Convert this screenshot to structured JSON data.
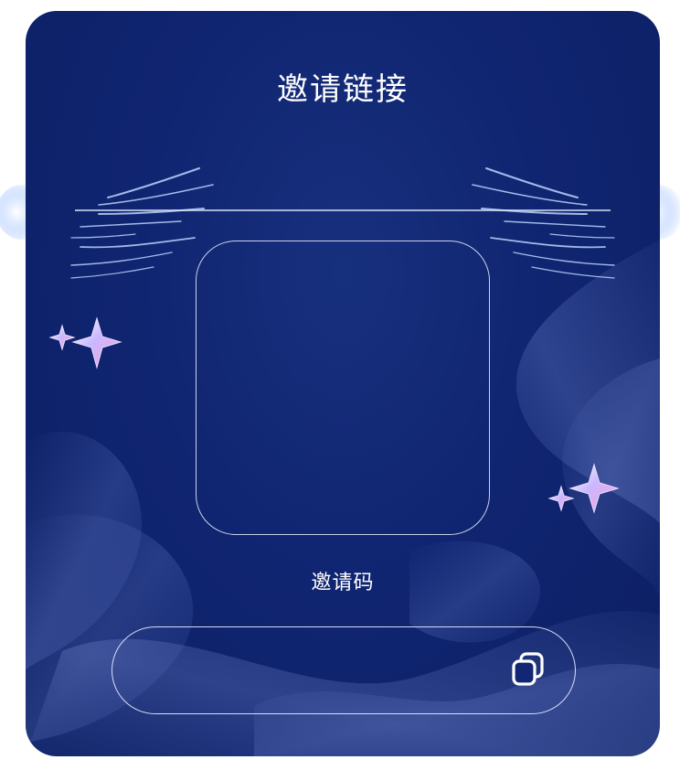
{
  "dialog": {
    "title": "邀请链接",
    "qr_code": "",
    "invite_code_label": "邀请码",
    "invite_code_value": ""
  },
  "icons": {
    "copy": "copy-icon",
    "stars": "sparkle-stars-icon"
  },
  "colors": {
    "background": "#102571",
    "background_dark": "#0c1f63",
    "text": "#ffffff",
    "border": "#ebf0ff"
  }
}
